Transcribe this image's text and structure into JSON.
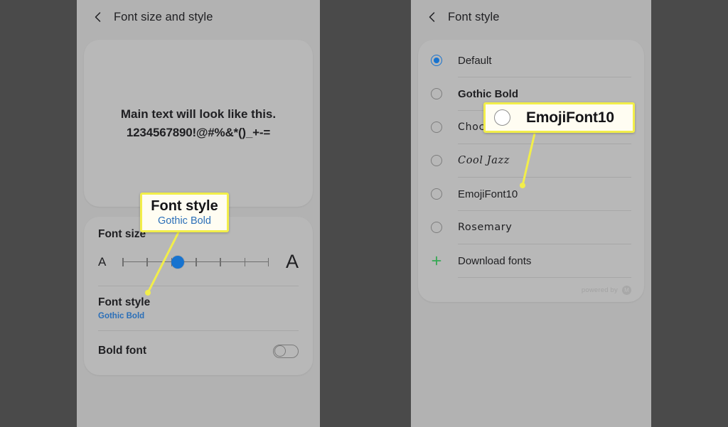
{
  "left_panel": {
    "header": {
      "back_icon": "chevron-left-icon",
      "title": "Font size and style"
    },
    "preview": {
      "line1": "Main text will look like this.",
      "line2": "1234567890!@#%&*()_+-="
    },
    "font_size": {
      "label": "Font size",
      "small_label": "A",
      "large_label": "A",
      "ticks": 7,
      "value_index": 2
    },
    "font_style": {
      "label": "Font style",
      "value": "Gothic Bold"
    },
    "bold_font": {
      "label": "Bold font",
      "toggle_state": "off"
    }
  },
  "right_panel": {
    "header": {
      "back_icon": "chevron-left-icon",
      "title": "Font style"
    },
    "fonts": [
      {
        "name": "Default",
        "selected": true,
        "style_class": "f-default"
      },
      {
        "name": "Gothic Bold",
        "selected": false,
        "style_class": "f-gothic"
      },
      {
        "name": "Choco",
        "selected": false,
        "style_class": "f-choco"
      },
      {
        "name": "Cool Jazz",
        "selected": false,
        "style_class": "f-cool"
      },
      {
        "name": "EmojiFont10",
        "selected": false,
        "style_class": "f-emoji"
      },
      {
        "name": "Rosemary",
        "selected": false,
        "style_class": "f-rose"
      }
    ],
    "download": {
      "icon": "plus-icon",
      "label": "Download fonts"
    },
    "footer": {
      "text": "powered by",
      "logo": "monotype-logo-icon"
    }
  },
  "annotations": {
    "left_callout": {
      "title": "Font style",
      "subtitle": "Gothic Bold"
    },
    "right_callout": {
      "title": "EmojiFont10",
      "radio": "radio-unselected-icon"
    }
  },
  "colors": {
    "backdrop": "#4a4a4a",
    "panel": "#b2b2b2",
    "card": "#b8b8b8",
    "accent_blue": "#1773cf",
    "link_blue": "#2b6fb8",
    "highlight_yellow": "#f2ee4a",
    "green_plus": "#35a853"
  }
}
